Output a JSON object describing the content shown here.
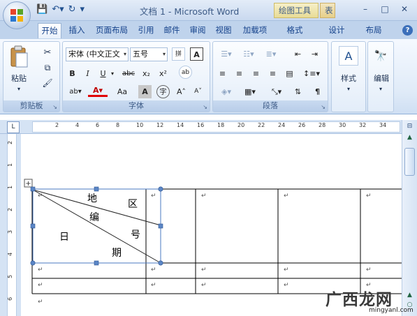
{
  "window": {
    "title": "文档 1 - Microsoft Word",
    "context_tabs": [
      "绘图工具",
      "表"
    ],
    "controls": [
      "–",
      "□",
      "✕"
    ]
  },
  "tabs": [
    "开始",
    "插入",
    "页面布局",
    "引用",
    "邮件",
    "审阅",
    "视图",
    "加载项",
    "格式",
    "设计",
    "布局"
  ],
  "active_tab": "开始",
  "ribbon": {
    "clipboard": {
      "label": "剪贴板",
      "paste": "粘贴"
    },
    "font": {
      "label": "字体",
      "font_name": "宋体 (中文正文",
      "font_size": "五号",
      "bold": "B",
      "italic": "I",
      "underline": "U",
      "strike": "abc",
      "sub": "x₂",
      "sup": "x²",
      "aa": "Aa",
      "A": "A",
      "grow": "A˄",
      "shrink": "A˅"
    },
    "paragraph": {
      "label": "段落"
    },
    "styles": {
      "label": "样式"
    },
    "editing": {
      "label": "编辑"
    }
  },
  "ruler_ticks": [
    "2",
    "4",
    "6",
    "8",
    "10",
    "12",
    "14",
    "16",
    "18",
    "20",
    "22",
    "24",
    "26",
    "28",
    "30",
    "32",
    "34"
  ],
  "vruler_ticks": [
    "2",
    "1",
    "1",
    "2",
    "3",
    "4",
    "5",
    "6"
  ],
  "table": {
    "header_text": {
      "di": "地",
      "qu": "区",
      "bian": "编",
      "hao": "号",
      "ri": "日",
      "qi": "期"
    }
  },
  "watermark": {
    "text": "广西龙网",
    "url": "mingyanl.com"
  },
  "colors": {
    "accent": "#15428b",
    "ribbon_bg": "#dfeaf7"
  }
}
